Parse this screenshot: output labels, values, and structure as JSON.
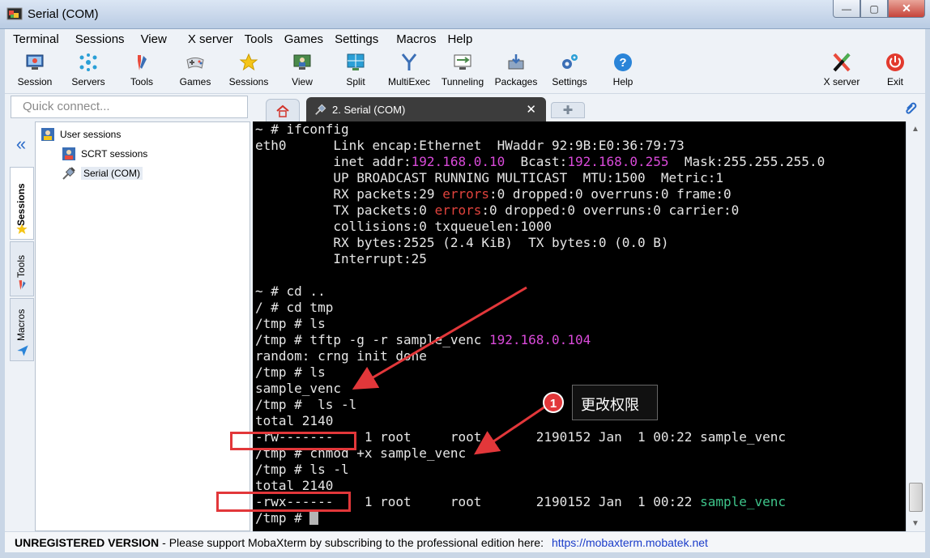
{
  "window": {
    "title": "Serial (COM)",
    "controls": {
      "minimize": "—",
      "maximize": "▢",
      "close": "✕"
    }
  },
  "menu": [
    "Terminal",
    "Sessions",
    "View",
    "X server",
    "Tools",
    "Games",
    "Settings",
    "Macros",
    "Help"
  ],
  "toolbar": {
    "items": [
      {
        "label": "Session",
        "icon": "session-icon"
      },
      {
        "label": "Servers",
        "icon": "servers-icon"
      },
      {
        "label": "Tools",
        "icon": "tools-icon"
      },
      {
        "label": "Games",
        "icon": "games-icon"
      },
      {
        "label": "Sessions",
        "icon": "sessions-star-icon"
      },
      {
        "label": "View",
        "icon": "view-icon"
      },
      {
        "label": "Split",
        "icon": "split-icon"
      },
      {
        "label": "MultiExec",
        "icon": "multiexec-icon"
      },
      {
        "label": "Tunneling",
        "icon": "tunneling-icon"
      },
      {
        "label": "Packages",
        "icon": "packages-icon"
      },
      {
        "label": "Settings",
        "icon": "settings-icon"
      },
      {
        "label": "Help",
        "icon": "help-icon"
      }
    ],
    "right": [
      {
        "label": "X server",
        "icon": "x-server-icon"
      },
      {
        "label": "Exit",
        "icon": "exit-icon"
      }
    ]
  },
  "quick_connect": {
    "placeholder": "Quick connect..."
  },
  "side_tabs": [
    "Sessions",
    "Tools",
    "Macros"
  ],
  "tree": {
    "root": "User sessions",
    "children": [
      "SCRT sessions",
      "Serial (COM)"
    ]
  },
  "tabs": {
    "active": "2. Serial (COM)"
  },
  "terminal": {
    "lines": [
      [
        {
          "t": "~ # ifconfig"
        }
      ],
      [
        {
          "t": "eth0      Link encap:Ethernet  HWaddr 92:9B:E0:36:79:73"
        }
      ],
      [
        {
          "t": "          inet addr:"
        },
        {
          "t": "192.168.0.10",
          "c": "mag"
        },
        {
          "t": "  Bcast:"
        },
        {
          "t": "192.168.0.255",
          "c": "mag"
        },
        {
          "t": "  Mask:255.255.255.0"
        }
      ],
      [
        {
          "t": "          UP BROADCAST RUNNING MULTICAST  MTU:1500  Metric:1"
        }
      ],
      [
        {
          "t": "          RX packets:29 "
        },
        {
          "t": "errors",
          "c": "red"
        },
        {
          "t": ":0 dropped:0 overruns:0 frame:0"
        }
      ],
      [
        {
          "t": "          TX packets:0 "
        },
        {
          "t": "errors",
          "c": "red"
        },
        {
          "t": ":0 dropped:0 overruns:0 carrier:0"
        }
      ],
      [
        {
          "t": "          collisions:0 txqueuelen:1000"
        }
      ],
      [
        {
          "t": "          RX bytes:2525 (2.4 KiB)  TX bytes:0 (0.0 B)"
        }
      ],
      [
        {
          "t": "          Interrupt:25"
        }
      ],
      [
        {
          "t": ""
        }
      ],
      [
        {
          "t": "~ # cd .."
        }
      ],
      [
        {
          "t": "/ # cd tmp"
        }
      ],
      [
        {
          "t": "/tmp # ls"
        }
      ],
      [
        {
          "t": "/tmp # tftp -g -r sample_venc "
        },
        {
          "t": "192.168.0.104",
          "c": "mag"
        }
      ],
      [
        {
          "t": "random: crng init done"
        }
      ],
      [
        {
          "t": "/tmp # ls"
        }
      ],
      [
        {
          "t": "sample_venc"
        }
      ],
      [
        {
          "t": "/tmp #  ls -l"
        }
      ],
      [
        {
          "t": "total 2140"
        }
      ],
      [
        {
          "t": "-rw-------    1 root     root       2190152 Jan  1 00:22 sample_venc"
        }
      ],
      [
        {
          "t": "/tmp # chmod +x sample_venc"
        }
      ],
      [
        {
          "t": "/tmp # ls -l"
        }
      ],
      [
        {
          "t": "total 2140"
        }
      ],
      [
        {
          "t": "-rwx------    1 root     root       2190152 Jan  1 00:22 "
        },
        {
          "t": "sample_venc",
          "c": "grn"
        }
      ],
      [
        {
          "t": "/tmp # "
        },
        {
          "t": "",
          "cursor": true
        }
      ]
    ]
  },
  "annotation": {
    "badge": "1",
    "text": "更改权限"
  },
  "status": {
    "unregistered": "UNREGISTERED VERSION",
    "message": "-  Please support MobaXterm by subscribing to the professional edition here:",
    "link": "https://mobaxterm.mobatek.net"
  },
  "colors": {
    "terminal_bg": "#000000",
    "ip_magenta": "#d94ad9",
    "error_red": "#e0433d",
    "exec_green": "#3ec48a",
    "annotation_red": "#e2373a"
  }
}
